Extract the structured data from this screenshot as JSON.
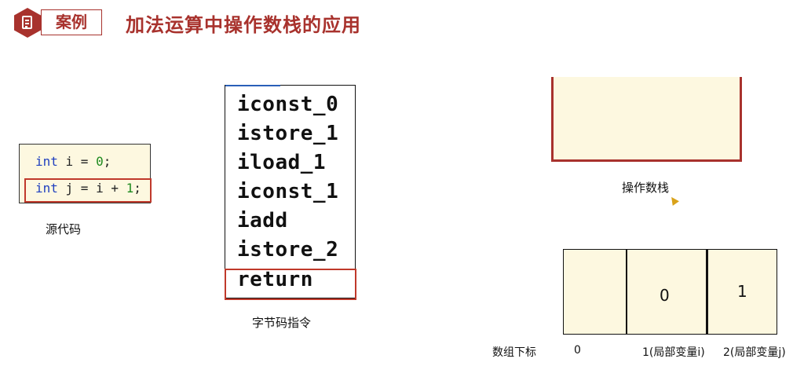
{
  "header": {
    "tag": "案例",
    "title": "加法运算中操作数栈的应用",
    "icon": "document-icon"
  },
  "source_code": {
    "line1": {
      "kw": "int",
      "rest": " i = ",
      "num": "0",
      "end": ";"
    },
    "line2": {
      "kw": "int",
      "rest": " j = i + ",
      "num": "1",
      "end": ";"
    },
    "label": "源代码"
  },
  "bytecode": {
    "instructions": [
      "iconst_0",
      "istore_1",
      "iload_1",
      "iconst_1",
      "iadd",
      "istore_2",
      "return"
    ],
    "label": "字节码指令"
  },
  "operand_stack": {
    "label": "操作数栈"
  },
  "local_vars": {
    "cells": [
      "",
      "0",
      "1"
    ],
    "index_label": "数组下标",
    "indices": [
      "0",
      "1(局部变量i)",
      "2(局部变量j)"
    ]
  },
  "colors": {
    "accent": "#a8322d",
    "highlight": "#c0392b",
    "panel_bg": "#fdf8e0"
  }
}
